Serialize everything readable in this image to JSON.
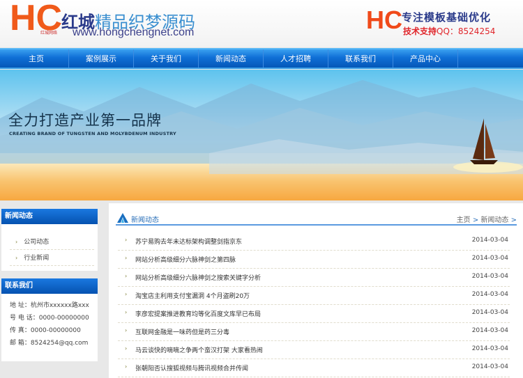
{
  "header": {
    "site_name_part1": "红城",
    "site_name_part2": "精品织梦源码",
    "site_url": "www.hongchengnet.com",
    "logo_text": "HC",
    "logo_sub": "红城网络",
    "slogan": "专注模板基础优化",
    "support_label": "技术支持",
    "support_qq": "QQ：8524254"
  },
  "nav": [
    "主页",
    "案例展示",
    "关于我们",
    "新闻动态",
    "人才招聘",
    "联系我们",
    "产品中心"
  ],
  "banner": {
    "title": "全力打造产业第一品牌",
    "subtitle": "CREATING BRAND OF TUNGSTEN AND MOLYBDENUM INDUSTRY"
  },
  "sidebar": {
    "news_title": "新闻动态",
    "news_links": [
      "公司动态",
      "行业新闻"
    ],
    "contact_title": "联系我们",
    "contact": [
      "地 址：杭州市xxxxxx路xxx",
      "号 电 话：0000-00000000",
      "传 真：0000-00000000",
      "邮 箱：8524254@qq.com"
    ]
  },
  "main": {
    "title": "新闻动态",
    "breadcrumb": [
      "主页",
      "新闻动态"
    ],
    "crumb_sep": ">",
    "news": [
      {
        "title": "苏宁易购去年未达标架构调整剑指京东",
        "date": "2014-03-04"
      },
      {
        "title": "网站分析高级细分六脉神剑之第四脉",
        "date": "2014-03-04"
      },
      {
        "title": "网站分析高级细分六脉神剑之搜索关键字分析",
        "date": "2014-03-04"
      },
      {
        "title": "淘宝店主利用支付宝漏洞 4个月盗刷20万",
        "date": "2014-03-04"
      },
      {
        "title": "李彦宏提案推进教育均等化百度文库早已布局",
        "date": "2014-03-04"
      },
      {
        "title": "互联网金融是一味药但是药三分毒",
        "date": "2014-03-04"
      },
      {
        "title": "马云谈快的嘀嘀之争两个蛮汉打架 大家看热闹",
        "date": "2014-03-04"
      },
      {
        "title": "张朝阳否认搜狐视频与腾讯视频合并传闻",
        "date": "2014-03-04"
      }
    ]
  }
}
